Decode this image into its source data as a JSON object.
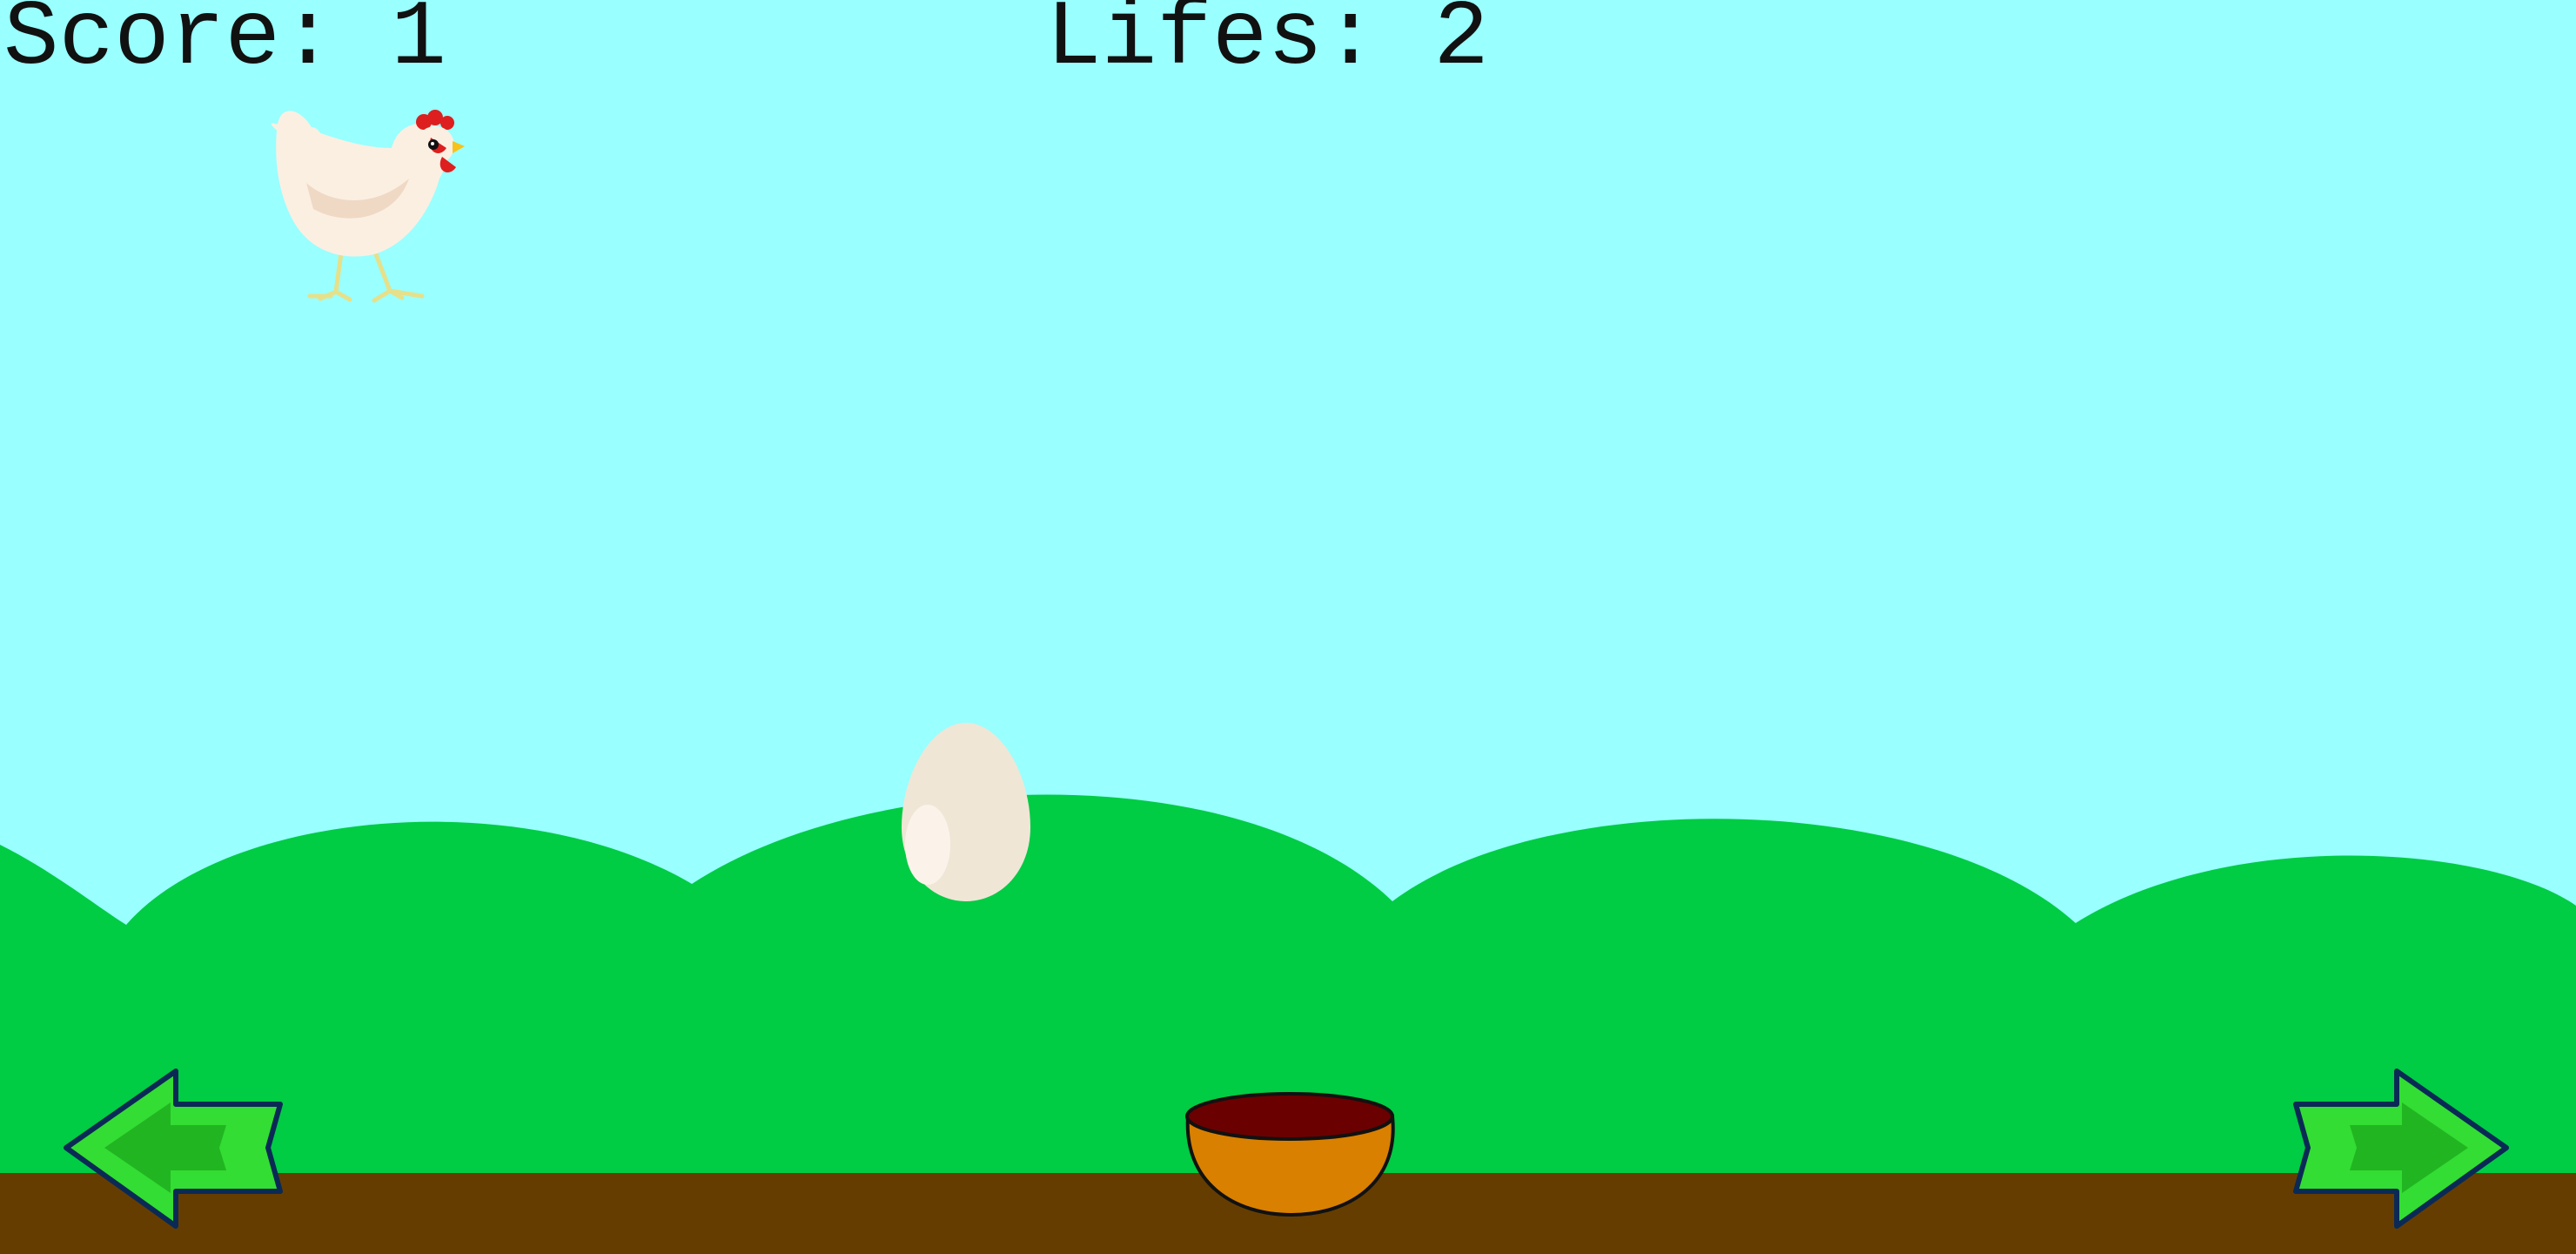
{
  "hud": {
    "score_text": "Score: 1",
    "lifes_text": "Lifes: 2"
  },
  "game_state": {
    "score": 1,
    "lifes": 2
  },
  "sprites": {
    "chicken": "chicken-icon",
    "egg": "egg-icon",
    "basket": "basket-icon",
    "left_control": "left-arrow-icon",
    "right_control": "right-arrow-icon"
  },
  "colors": {
    "sky": "#99ffff",
    "hills": "#00cc44",
    "ground": "#663d00",
    "basket": "#d98000",
    "basket_inner": "#6b0000",
    "arrow": "#33dd33",
    "arrow_outline": "#0a2a55",
    "egg": "#f0e6d6"
  }
}
